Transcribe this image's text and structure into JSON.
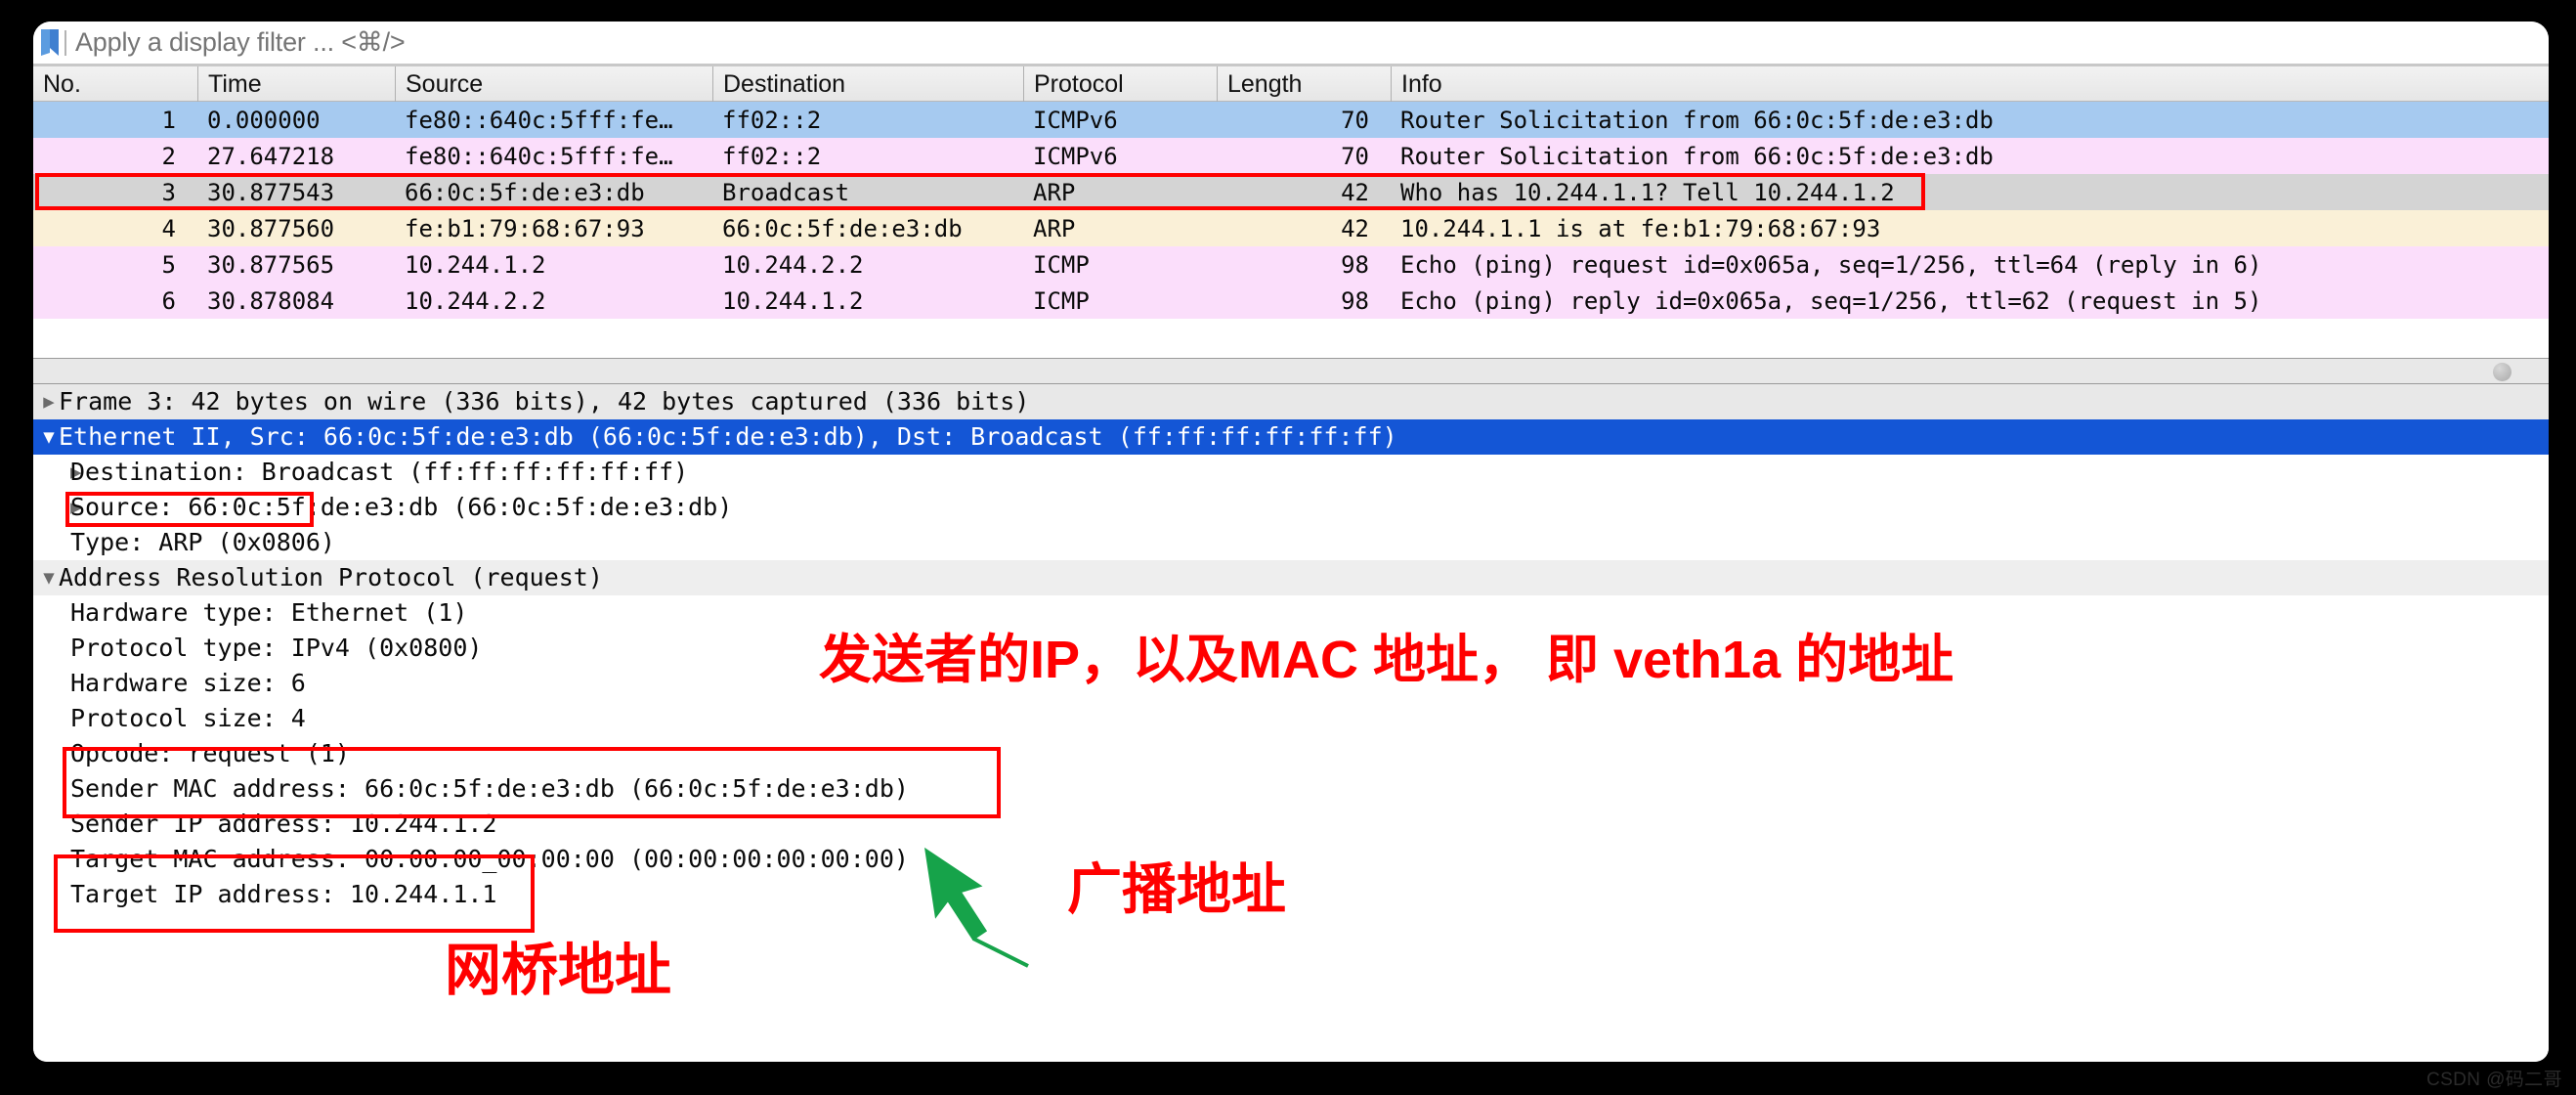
{
  "filter": {
    "placeholder": "Apply a display filter ... <⌘/>",
    "value": "",
    "bookmark_icon": "bookmark-icon"
  },
  "packet_list": {
    "columns": [
      "No.",
      "Time",
      "Source",
      "Destination",
      "Protocol",
      "Length",
      "Info"
    ],
    "rows": [
      {
        "no": "1",
        "time": "0.000000",
        "source": "fe80::640c:5fff:fe…",
        "destination": "ff02::2",
        "protocol": "ICMPv6",
        "length": "70",
        "info": "Router Solicitation from 66:0c:5f:de:e3:db",
        "color": "#a6caf0"
      },
      {
        "no": "2",
        "time": "27.647218",
        "source": "fe80::640c:5fff:fe…",
        "destination": "ff02::2",
        "protocol": "ICMPv6",
        "length": "70",
        "info": "Router Solicitation from 66:0c:5f:de:e3:db",
        "color": "#fbdefb"
      },
      {
        "no": "3",
        "time": "30.877543",
        "source": "66:0c:5f:de:e3:db",
        "destination": "Broadcast",
        "protocol": "ARP",
        "length": "42",
        "info": "Who has 10.244.1.1? Tell 10.244.1.2",
        "color": "#d4d4d4"
      },
      {
        "no": "4",
        "time": "30.877560",
        "source": "fe:b1:79:68:67:93",
        "destination": "66:0c:5f:de:e3:db",
        "protocol": "ARP",
        "length": "42",
        "info": "10.244.1.1 is at fe:b1:79:68:67:93",
        "color": "#faf0d7"
      },
      {
        "no": "5",
        "time": "30.877565",
        "source": "10.244.1.2",
        "destination": "10.244.2.2",
        "protocol": "ICMP",
        "length": "98",
        "info": "Echo (ping) request  id=0x065a, seq=1/256, ttl=64 (reply in 6)",
        "color": "#fbdefb"
      },
      {
        "no": "6",
        "time": "30.878084",
        "source": "10.244.2.2",
        "destination": "10.244.1.2",
        "protocol": "ICMP",
        "length": "98",
        "info": "Echo (ping) reply    id=0x065a, seq=1/256, ttl=62 (request in 5)",
        "color": "#fbdefb"
      }
    ]
  },
  "detail_tree": [
    {
      "twist": "▶",
      "indent": 0,
      "text": "Frame 3: 42 bytes on wire (336 bits), 42 bytes captured (336 bits)",
      "style": "frame-row"
    },
    {
      "twist": "▼",
      "indent": 0,
      "text": "Ethernet II, Src: 66:0c:5f:de:e3:db (66:0c:5f:de:e3:db), Dst: Broadcast (ff:ff:ff:ff:ff:ff)",
      "style": "sel"
    },
    {
      "twist": "▶",
      "indent": 1,
      "text": "Destination: Broadcast (ff:ff:ff:ff:ff:ff)",
      "style": ""
    },
    {
      "twist": "▶",
      "indent": 1,
      "text": "Source: 66:0c:5f:de:e3:db (66:0c:5f:de:e3:db)",
      "style": ""
    },
    {
      "twist": "",
      "indent": 1,
      "text": "Type: ARP (0x0806)",
      "style": ""
    },
    {
      "twist": "▼",
      "indent": 0,
      "text": "Address Resolution Protocol (request)",
      "style": "arp-root"
    },
    {
      "twist": "",
      "indent": 1,
      "text": "Hardware type: Ethernet (1)",
      "style": ""
    },
    {
      "twist": "",
      "indent": 1,
      "text": "Protocol type: IPv4 (0x0800)",
      "style": ""
    },
    {
      "twist": "",
      "indent": 1,
      "text": "Hardware size: 6",
      "style": ""
    },
    {
      "twist": "",
      "indent": 1,
      "text": "Protocol size: 4",
      "style": ""
    },
    {
      "twist": "",
      "indent": 1,
      "text": "Opcode: request (1)",
      "style": ""
    },
    {
      "twist": "",
      "indent": 1,
      "text": "Sender MAC address: 66:0c:5f:de:e3:db (66:0c:5f:de:e3:db)",
      "style": ""
    },
    {
      "twist": "",
      "indent": 1,
      "text": "Sender IP address: 10.244.1.2",
      "style": ""
    },
    {
      "twist": "",
      "indent": 1,
      "text": "Target MAC address: 00:00:00_00:00:00 (00:00:00:00:00:00)",
      "style": ""
    },
    {
      "twist": "",
      "indent": 1,
      "text": "Target IP address: 10.244.1.1",
      "style": ""
    }
  ],
  "annotations": {
    "accent_color": "#ff0000",
    "arrow_color": "#16a34a",
    "sender_note": "发送者的IP，以及MAC 地址， 即 veth1a 的地址",
    "broadcast_note": "广播地址",
    "bridge_note": "网桥地址"
  },
  "watermark": "CSDN @码二哥"
}
